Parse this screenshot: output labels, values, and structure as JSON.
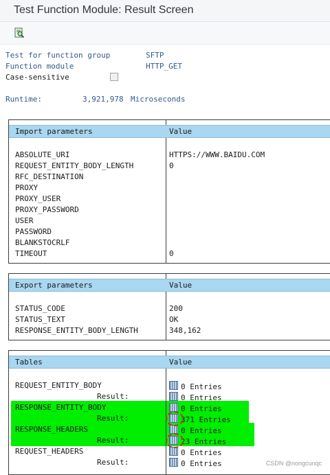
{
  "window": {
    "title": "Test Function Module: Result Screen"
  },
  "toolbar": {
    "icon": "search-document-icon"
  },
  "info": {
    "fg_label": "Test for function group",
    "fg_value": "SFTP",
    "fm_label": "Function module",
    "fm_value": "HTTP_GET",
    "cs_label": "Case-sensitive",
    "runtime_label": "Runtime:",
    "runtime_value": "3,921,978",
    "runtime_unit": "Microseconds"
  },
  "import": {
    "header": "Import parameters",
    "value_header": "Value",
    "rows": [
      {
        "name": "ABSOLUTE_URI",
        "value": "HTTPS://WWW.BAIDU.COM"
      },
      {
        "name": "REQUEST_ENTITY_BODY_LENGTH",
        "value": "0"
      },
      {
        "name": "RFC_DESTINATION",
        "value": ""
      },
      {
        "name": "PROXY",
        "value": ""
      },
      {
        "name": "PROXY_USER",
        "value": ""
      },
      {
        "name": "PROXY_PASSWORD",
        "value": ""
      },
      {
        "name": "USER",
        "value": ""
      },
      {
        "name": "PASSWORD",
        "value": ""
      },
      {
        "name": "BLANKSTOCRLF",
        "value": ""
      },
      {
        "name": "TIMEOUT",
        "value": "0"
      }
    ]
  },
  "export": {
    "header": "Export parameters",
    "value_header": "Value",
    "rows": [
      {
        "name": "STATUS_CODE",
        "value": "200"
      },
      {
        "name": "STATUS_TEXT",
        "value": "OK"
      },
      {
        "name": "RESPONSE_ENTITY_BODY_LENGTH",
        "value": "348,162"
      }
    ]
  },
  "tables": {
    "header": "Tables",
    "value_header": "Value",
    "result_label": "Result:",
    "rows": [
      {
        "name": "REQUEST_ENTITY_BODY",
        "value": "0 Entries",
        "result": "0 Entries"
      },
      {
        "name": "RESPONSE_ENTITY_BODY",
        "value": "0 Entries",
        "result": "371 Entries"
      },
      {
        "name": "RESPONSE_HEADERS",
        "value": "0 Entries",
        "result": "23 Entries"
      },
      {
        "name": "REQUEST_HEADERS",
        "value": "0 Entries",
        "result": "0 Entries"
      }
    ]
  },
  "watermark": "CSDN @nongcunqc",
  "colors": {
    "header_bg": "#a9d6f0",
    "highlight": "#00ee00",
    "annotation": "#e0202a",
    "label_blue": "#2f5a8c"
  }
}
